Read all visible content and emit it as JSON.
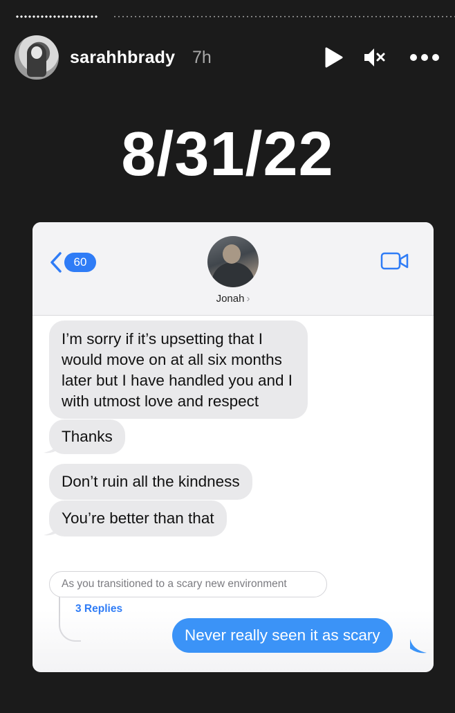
{
  "story": {
    "progress_fraction": 0.19,
    "user": {
      "username": "sarahhbrady",
      "time_ago": "7h"
    },
    "controls": [
      "play-icon",
      "mute-icon",
      "more-icon"
    ],
    "caption_date": "8/31/22"
  },
  "imessage": {
    "back_count": "60",
    "contact_name": "Jonah",
    "contact_chevron": "›",
    "accent_color": "#2f7cf6",
    "messages": [
      {
        "from": "them",
        "text": "I’m sorry if it’s upsetting that I would move on at all six months later but I have handled you and I with utmost love and respect"
      },
      {
        "from": "them",
        "text": "Thanks"
      },
      {
        "from": "them",
        "text": "Don’t ruin all the kindness"
      },
      {
        "from": "them",
        "text": "You’re better than that"
      }
    ],
    "quoted_reply": "As you transitioned to a scary new environment",
    "replies_label": "3 Replies",
    "sent_message": "Never really seen it as scary"
  }
}
